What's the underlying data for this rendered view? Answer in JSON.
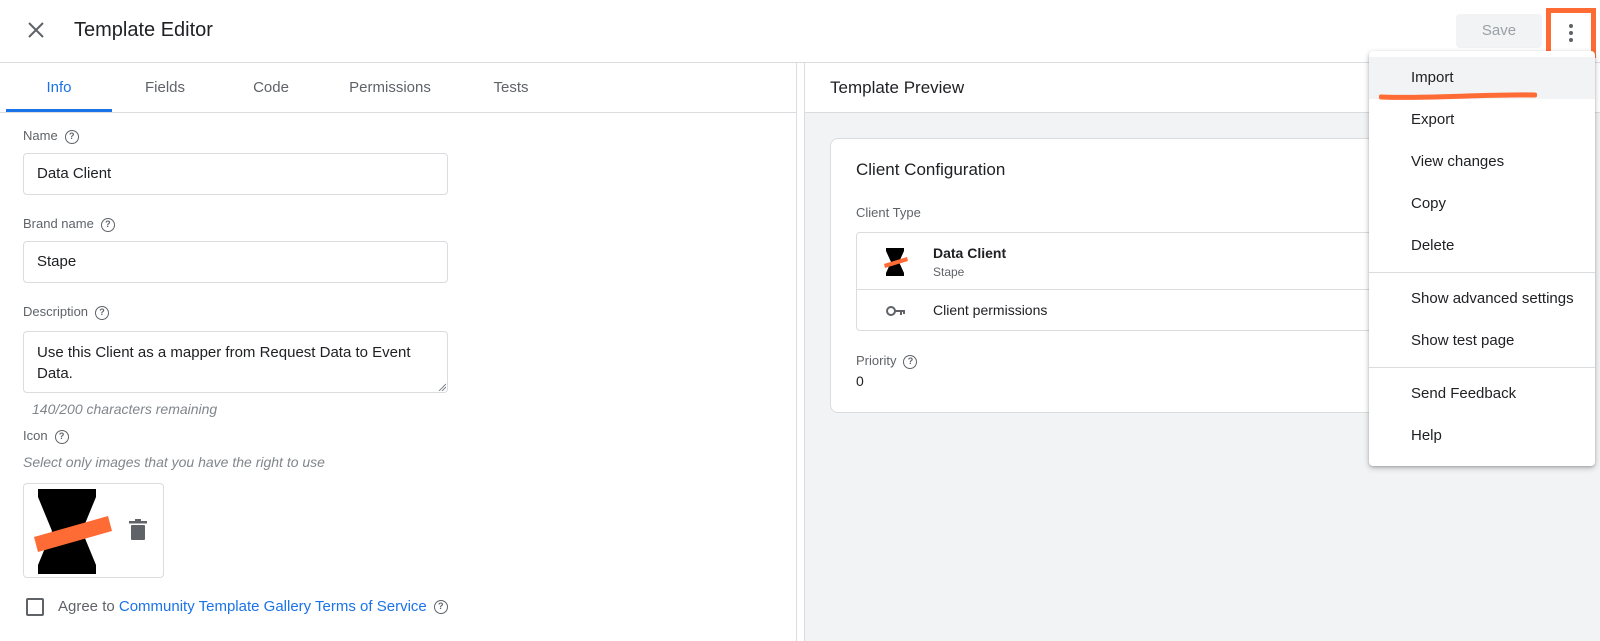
{
  "header": {
    "title": "Template Editor",
    "save_label": "Save"
  },
  "tabs": [
    {
      "label": "Info",
      "active": true
    },
    {
      "label": "Fields"
    },
    {
      "label": "Code"
    },
    {
      "label": "Permissions"
    },
    {
      "label": "Tests"
    }
  ],
  "form": {
    "name_label": "Name",
    "name_value": "Data Client",
    "brand_label": "Brand name",
    "brand_value": "Stape",
    "description_label": "Description",
    "description_value": "Use this Client as a mapper from Request Data to Event Data.",
    "char_count": "140/200 characters remaining",
    "icon_label": "Icon",
    "icon_hint": "Select only images that you have the right to use",
    "agree_prefix": "Agree to ",
    "agree_link": "Community Template Gallery Terms of Service",
    "agree_checked": false
  },
  "preview": {
    "title": "Template Preview",
    "card_title": "Client Configuration",
    "client_type_label": "Client Type",
    "client_name": "Data Client",
    "client_brand": "Stape",
    "permissions_label": "Client permissions",
    "priority_label": "Priority",
    "priority_value": "0"
  },
  "menu": {
    "items": [
      {
        "label": "Import",
        "highlighted": true
      },
      {
        "label": "Export"
      },
      {
        "label": "View changes"
      },
      {
        "label": "Copy"
      },
      {
        "label": "Delete"
      },
      {
        "label": "Show advanced settings"
      },
      {
        "label": "Show test page"
      },
      {
        "label": "Send Feedback"
      },
      {
        "label": "Help"
      }
    ]
  },
  "colors": {
    "accent": "#1a73e8",
    "annotation_orange": "#ff6b35",
    "text_secondary": "#5f6368",
    "border": "#dadce0"
  },
  "icons": {
    "close": "close-icon",
    "more": "more-vert-icon",
    "help": "help-circle-icon",
    "trash": "trash-icon",
    "key": "key-icon",
    "logo": "stape-logo-icon"
  }
}
